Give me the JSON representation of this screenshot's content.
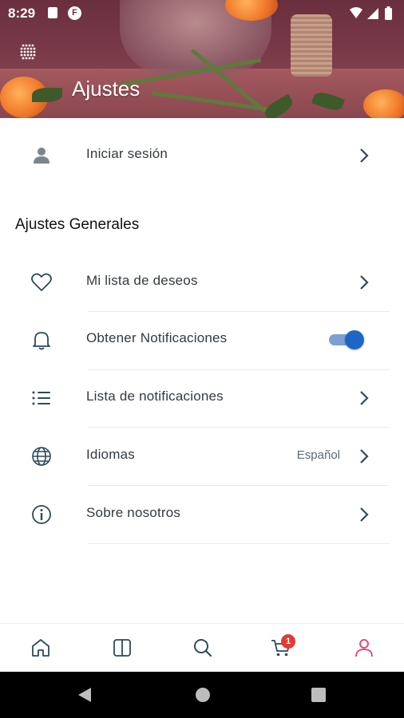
{
  "status_bar": {
    "time": "8:29",
    "app_letter": "F"
  },
  "header": {
    "title": "Ajustes"
  },
  "account": {
    "login_label": "Iniciar sesión"
  },
  "general": {
    "section_title": "Ajustes Generales",
    "items": [
      {
        "label": "Mi lista de deseos",
        "icon": "heart-icon"
      },
      {
        "label": "Obtener Notificaciones",
        "icon": "bell-icon",
        "toggle_on": true
      },
      {
        "label": "Lista de notificaciones",
        "icon": "list-icon"
      },
      {
        "label": "Idiomas",
        "icon": "globe-icon",
        "value": "Español"
      },
      {
        "label": "Sobre nosotros",
        "icon": "info-icon"
      }
    ]
  },
  "bottom_nav": {
    "items": [
      "home-icon",
      "catalog-icon",
      "search-icon",
      "cart-icon",
      "profile-icon"
    ],
    "cart_badge": "1",
    "active": "profile-icon"
  },
  "colors": {
    "accent": "#1f65c8",
    "active_nav": "#e23e6b",
    "icon": "#2d4a5a",
    "badge": "#e53935"
  }
}
